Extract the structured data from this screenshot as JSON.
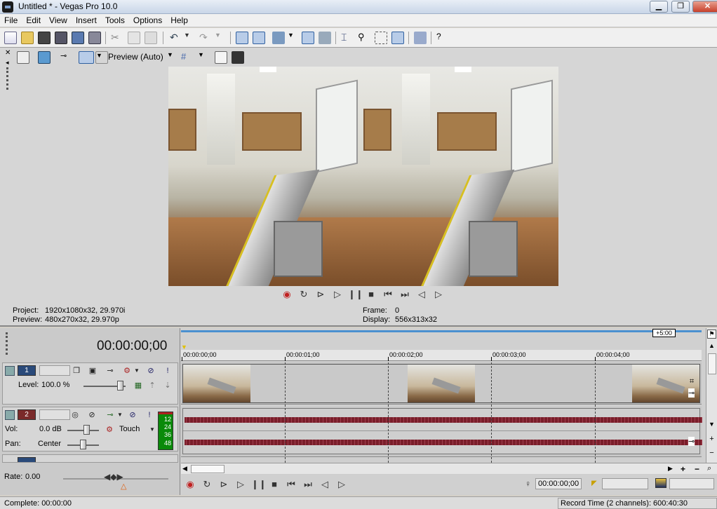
{
  "window": {
    "title": "Untitled * - Vegas Pro 10.0",
    "minimize": "▁",
    "maximize": "❐",
    "close": "✕"
  },
  "menu": [
    "File",
    "Edit",
    "View",
    "Insert",
    "Tools",
    "Options",
    "Help"
  ],
  "preview": {
    "quality_label": "Preview (Auto)",
    "project_label": "Project:",
    "project_value": "1920x1080x32, 29.970i",
    "preview_label": "Preview:",
    "preview_value": "480x270x32, 29.970p",
    "frame_label": "Frame:",
    "frame_value": "0",
    "display_label": "Display:",
    "display_value": "556x313x32"
  },
  "timeline": {
    "timecode": "00:00:00;00",
    "ruler_badge": "+5:00",
    "ruler_ticks": [
      "00:00:00;00",
      "00:00:01;00",
      "00:00:02;00",
      "00:00:03;00",
      "00:00:04;00"
    ],
    "video_track": {
      "number": "1",
      "level_label": "Level:",
      "level_value": "100.0 %"
    },
    "audio_track": {
      "number": "2",
      "vol_label": "Vol:",
      "vol_value": "0.0 dB",
      "automation_mode": "Touch",
      "pan_label": "Pan:",
      "pan_value": "Center",
      "meter_labels": [
        "12",
        "24",
        "36",
        "48"
      ]
    },
    "rate_label": "Rate:",
    "rate_value": "0.00",
    "cursor_position": "00:00:00;00"
  },
  "status": {
    "complete": "Complete: 00:00:00",
    "record_time": "Record Time (2 channels): 600:40:30"
  },
  "colors": {
    "accent_blue": "#4a90d0",
    "waveform": "#7a1e2a",
    "video_track": "#2a4a7a",
    "audio_track": "#7a2a2a",
    "meter_green": "#0a8a0a"
  }
}
